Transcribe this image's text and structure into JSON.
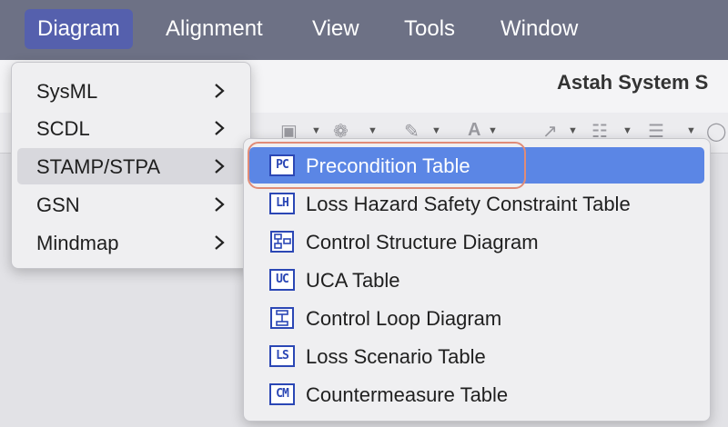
{
  "menubar": {
    "items": [
      {
        "label": "Diagram"
      },
      {
        "label": "Alignment"
      },
      {
        "label": "View"
      },
      {
        "label": "Tools"
      },
      {
        "label": "Window"
      }
    ]
  },
  "app": {
    "title": "Astah System S"
  },
  "diagram_menu": {
    "items": [
      {
        "label": "SysML"
      },
      {
        "label": "SCDL"
      },
      {
        "label": "STAMP/STPA"
      },
      {
        "label": "GSN"
      },
      {
        "label": "Mindmap"
      }
    ]
  },
  "stamp_submenu": {
    "items": [
      {
        "label": "Precondition Table",
        "icon": "precondition-table-icon",
        "icon_text": "PC"
      },
      {
        "label": "Loss Hazard Safety Constraint Table",
        "icon": "loss-hazard-table-icon",
        "icon_text": "LH"
      },
      {
        "label": "Control Structure Diagram",
        "icon": "control-structure-icon",
        "icon_text": ""
      },
      {
        "label": "UCA Table",
        "icon": "uca-table-icon",
        "icon_text": "UC"
      },
      {
        "label": "Control Loop Diagram",
        "icon": "control-loop-icon",
        "icon_text": ""
      },
      {
        "label": "Loss Scenario Table",
        "icon": "loss-scenario-table-icon",
        "icon_text": "LS"
      },
      {
        "label": "Countermeasure Table",
        "icon": "countermeasure-table-icon",
        "icon_text": "CM"
      }
    ]
  },
  "colors": {
    "menubar": "#6d7185",
    "active_menu": "#5560ad",
    "selection": "#5b86e5",
    "icon_blue": "#2b47b5",
    "highlight": "#e08c78"
  }
}
